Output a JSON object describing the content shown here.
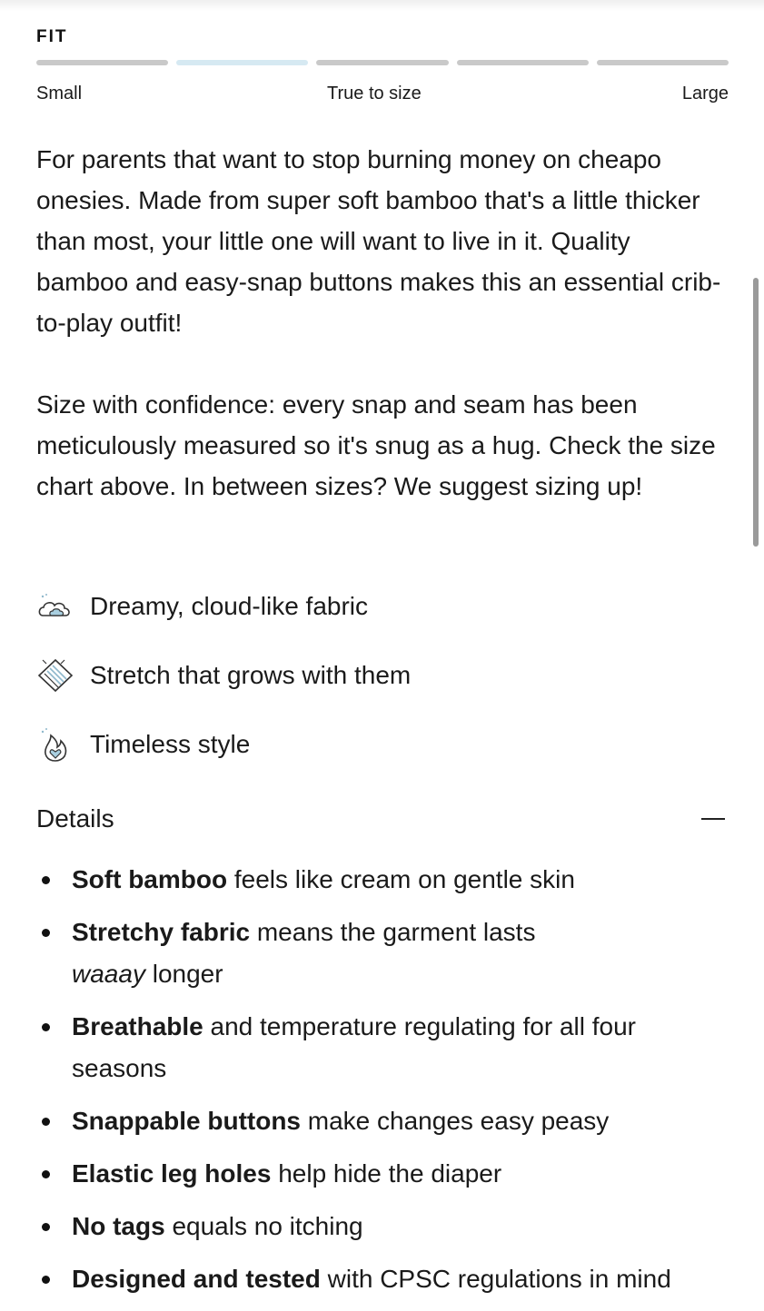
{
  "fit": {
    "label": "FIT",
    "segments": 5,
    "active_segment_index": 1,
    "scale_small": "Small",
    "scale_true": "True to size",
    "scale_large": "Large"
  },
  "description": {
    "paragraph_1": "For parents that want to stop burning money on cheapo onesies. Made from super soft bamboo that's a little thicker than most, your little one will want to live in it. Quality bamboo and easy-snap buttons makes this an essential crib-to-play outfit!",
    "paragraph_2": "Size with confidence: every snap and seam has been meticulously measured so it's snug as a hug. Check the size chart above. In between sizes? We suggest sizing up!"
  },
  "features": [
    {
      "icon": "cloud-icon",
      "text": "Dreamy, cloud-like fabric"
    },
    {
      "icon": "stretch-fabric-icon",
      "text": "Stretch that grows with them"
    },
    {
      "icon": "flame-heart-icon",
      "text": "Timeless style"
    }
  ],
  "details": {
    "title": "Details",
    "toggle_icon": "minus-icon",
    "items": [
      {
        "bold": "Soft bamboo",
        "rest": " feels like cream on gentle skin"
      },
      {
        "bold": "Stretchy fabric",
        "rest_before": " means the garment lasts ",
        "italic": "waaay",
        "rest": " longer"
      },
      {
        "bold": "Breathable",
        "rest": " and temperature regulating for all four seasons"
      },
      {
        "bold": "Snappable buttons",
        "rest": " make changes easy peasy"
      },
      {
        "bold": "Elastic leg holes",
        "rest": " help hide the diaper"
      },
      {
        "bold": "No tags",
        "rest": " equals no itching"
      },
      {
        "bold": "Designed and tested",
        "rest": " with CPSC regulations in mind"
      }
    ]
  },
  "colors": {
    "text": "#1a1a1a",
    "fit_inactive": "#c9c9c9",
    "fit_active": "#d6e9f2",
    "icon_accent": "#8fb8cc"
  }
}
